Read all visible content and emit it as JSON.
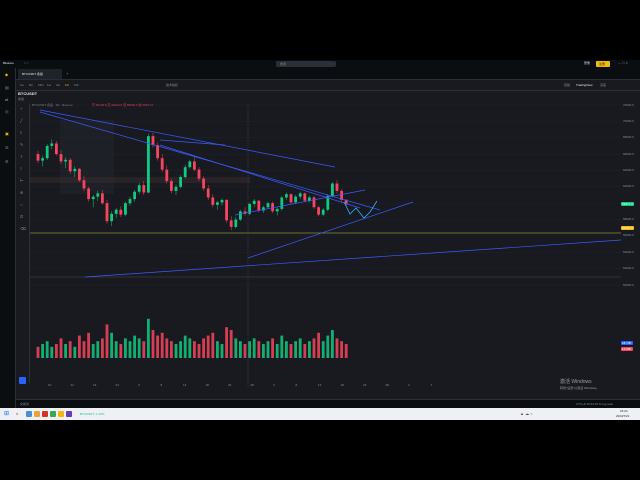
{
  "app": {
    "name": "Binance",
    "tab_label": "BTCUSDT 永续",
    "search_placeholder": "搜索",
    "login_label": "登录",
    "register_label": "注册"
  },
  "toolbar": {
    "items": [
      "1m",
      "5m",
      "15m",
      "1H",
      "4H",
      "1D",
      "1W"
    ],
    "indicators_label": "技术指标",
    "views": [
      "原始",
      "TradingView",
      "深度"
    ]
  },
  "symbol": {
    "name": "BTCUSDT",
    "sub": "永续",
    "legend_line1": "BTCUSDT 永续 · 1D · Binance",
    "legend_ohlc": "开 59400.8  高 60210.0  低 58560.0  收 59874.0"
  },
  "price_axis": [
    "72000.0",
    "70000.0",
    "68000.0",
    "66000.0",
    "64000.0",
    "62000.0",
    "60000.0",
    "58000.0",
    "56000.0",
    "54000.0",
    "52000.0",
    "50000.0"
  ],
  "price_tags": [
    {
      "label": "59874.0",
      "color": "#0ecb81"
    },
    {
      "label": "56930.0",
      "color": "#f0b90b"
    },
    {
      "label": "18.70K",
      "color": "#2962ff"
    },
    {
      "label": "12.95K",
      "color": "#f6465d"
    }
  ],
  "time_axis": [
    "10",
    "14",
    "19",
    "24",
    "3",
    "8",
    "13",
    "18",
    "23",
    "28",
    "3",
    "8",
    "13",
    "18",
    "23",
    "28",
    "2",
    "7"
  ],
  "status": {
    "left": "交易对",
    "right": "UTC+8  15:24:10  %  log  auto"
  },
  "watermark": {
    "line1": "激活 Windows",
    "line2": "转到\"设置\"以激活 Windows。"
  },
  "taskbar": {
    "ticker1": "BTCUSDT -1.23%",
    "clock_time": "15:24",
    "clock_date": "2024/7/21"
  },
  "colors": {
    "up": "#0ecb81",
    "down": "#f6465d",
    "trend": "#3d5afe",
    "level": "#c6c63a"
  },
  "chart_data": {
    "type": "candlestick",
    "series": [
      {
        "name": "",
        "values": [
          [
            66000,
            66400,
            64900,
            65200
          ],
          [
            65200,
            65800,
            64500,
            65500
          ],
          [
            65500,
            67200,
            65300,
            67000
          ],
          [
            67000,
            67800,
            66600,
            67300
          ],
          [
            67300,
            67600,
            65800,
            66000
          ],
          [
            66000,
            66500,
            64800,
            65100
          ],
          [
            65100,
            65600,
            64300,
            65300
          ],
          [
            65300,
            65500,
            63600,
            63900
          ],
          [
            63900,
            64500,
            63200,
            64200
          ],
          [
            64200,
            64300,
            62600,
            62800
          ],
          [
            62800,
            63300,
            61500,
            61800
          ],
          [
            61800,
            62000,
            60200,
            60500
          ],
          [
            60500,
            61000,
            59500,
            60800
          ],
          [
            60800,
            61500,
            60300,
            61200
          ],
          [
            61200,
            61600,
            59800,
            60000
          ],
          [
            60000,
            60400,
            57500,
            57800
          ],
          [
            57800,
            59000,
            57200,
            58700
          ],
          [
            58700,
            59400,
            58200,
            59200
          ],
          [
            59200,
            59600,
            58300,
            58600
          ],
          [
            58600,
            60200,
            58400,
            60000
          ],
          [
            60000,
            60800,
            59700,
            60500
          ],
          [
            60500,
            61600,
            60200,
            61400
          ],
          [
            61400,
            62500,
            61100,
            62200
          ],
          [
            62200,
            62700,
            61000,
            61300
          ],
          [
            61300,
            68500,
            61200,
            68200
          ],
          [
            68200,
            68600,
            66800,
            67100
          ],
          [
            67100,
            67400,
            65200,
            65500
          ],
          [
            65500,
            66000,
            63800,
            64100
          ],
          [
            64100,
            64600,
            62400,
            62700
          ],
          [
            62700,
            63000,
            61200,
            61500
          ],
          [
            61500,
            62300,
            61000,
            62000
          ],
          [
            62000,
            63400,
            61800,
            63200
          ],
          [
            63200,
            64700,
            63000,
            64400
          ],
          [
            64400,
            65300,
            64200,
            65100
          ],
          [
            65100,
            65600,
            63900,
            64100
          ],
          [
            64100,
            64400,
            62700,
            63000
          ],
          [
            63000,
            63300,
            61500,
            61800
          ],
          [
            61800,
            62200,
            60400,
            60700
          ],
          [
            60700,
            61100,
            59500,
            59800
          ],
          [
            59800,
            60300,
            59200,
            60100
          ],
          [
            60100,
            60600,
            59700,
            60400
          ],
          [
            60400,
            60500,
            57600,
            57900
          ],
          [
            57900,
            58400,
            56700,
            57100
          ],
          [
            57100,
            58300,
            56900,
            58000
          ],
          [
            58000,
            59200,
            57800,
            59000
          ],
          [
            59000,
            59500,
            58500,
            58700
          ],
          [
            58700,
            60100,
            58500,
            59900
          ],
          [
            59900,
            60500,
            59500,
            60300
          ],
          [
            60300,
            60400,
            58900,
            59100
          ],
          [
            59100,
            59700,
            58800,
            59500
          ],
          [
            59500,
            60200,
            59300,
            60000
          ],
          [
            60000,
            60200,
            58800,
            59000
          ],
          [
            59000,
            59500,
            58500,
            59300
          ],
          [
            59300,
            60900,
            59100,
            60700
          ],
          [
            60700,
            61300,
            60400,
            61100
          ],
          [
            61100,
            61200,
            59900,
            60100
          ],
          [
            60100,
            61000,
            59900,
            60800
          ],
          [
            60800,
            61400,
            60500,
            61200
          ],
          [
            61200,
            61300,
            60100,
            60300
          ],
          [
            60300,
            60900,
            60100,
            60700
          ],
          [
            60700,
            60900,
            59300,
            59500
          ],
          [
            59500,
            59700,
            58400,
            58600
          ],
          [
            58600,
            59400,
            58400,
            59200
          ],
          [
            59200,
            61100,
            59000,
            60900
          ],
          [
            60900,
            62600,
            60700,
            62400
          ],
          [
            62400,
            62800,
            61200,
            61500
          ],
          [
            61500,
            61700,
            60200,
            60400
          ],
          [
            60400,
            60500,
            59600,
            59874
          ]
        ]
      }
    ],
    "volume": [
      4,
      5,
      6,
      4,
      5,
      7,
      5,
      6,
      4,
      8,
      6,
      9,
      5,
      6,
      7,
      12,
      9,
      6,
      5,
      7,
      6,
      8,
      7,
      6,
      14,
      10,
      8,
      9,
      7,
      6,
      5,
      6,
      8,
      7,
      6,
      5,
      7,
      8,
      9,
      6,
      5,
      11,
      10,
      7,
      6,
      5,
      6,
      7,
      6,
      5,
      6,
      7,
      5,
      8,
      6,
      5,
      6,
      7,
      5,
      6,
      7,
      9,
      6,
      8,
      10,
      7,
      6,
      5
    ],
    "ylim": [
      50000,
      72000
    ]
  }
}
